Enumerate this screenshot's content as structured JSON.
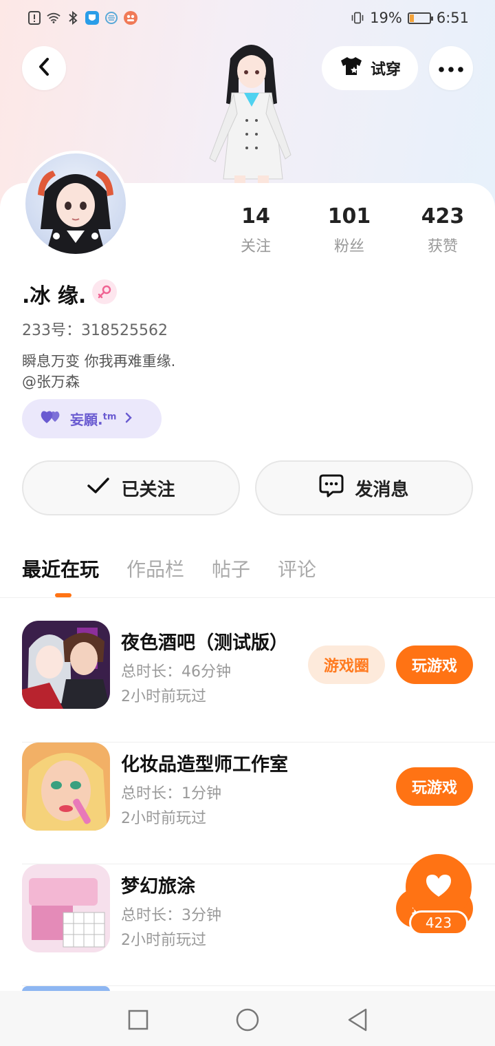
{
  "status_bar": {
    "battery": "19%",
    "battery_level": 0.19,
    "time": "6:51"
  },
  "header": {
    "try_on_label": "试穿",
    "icons": [
      "back-icon",
      "tshirt-icon",
      "more-icon"
    ]
  },
  "profile": {
    "username": ".冰 缘.",
    "gender_icon": "female-icon",
    "id_line": "233号：318525562",
    "bio_line1": "瞬息万变 你我再难重缘.",
    "bio_line2": "@张万森",
    "pill_label": "妄願.",
    "pill_sup": "tm",
    "stats": [
      {
        "num": "14",
        "label": "关注"
      },
      {
        "num": "101",
        "label": "粉丝"
      },
      {
        "num": "423",
        "label": "获赞"
      }
    ]
  },
  "actions": {
    "followed": "已关注",
    "message": "发消息"
  },
  "tabs": [
    "最近在玩",
    "作品栏",
    "帖子",
    "评论"
  ],
  "games": [
    {
      "title": "夜色酒吧（测试版）",
      "duration": "总时长：46分钟",
      "ago": "2小时前玩过",
      "circle_label": "游戏圈",
      "play_label": "玩游戏"
    },
    {
      "title": "化妆品造型师工作室",
      "duration": "总时长：1分钟",
      "ago": "2小时前玩过",
      "play_label": "玩游戏"
    },
    {
      "title": "梦幻旅涂",
      "duration": "总时长：3分钟",
      "ago": "2小时前玩过",
      "play_label": "玩游戏"
    }
  ],
  "like_fab": {
    "count": "423"
  },
  "colors": {
    "accent": "#ff7314",
    "pill": "#6a5bd1"
  }
}
